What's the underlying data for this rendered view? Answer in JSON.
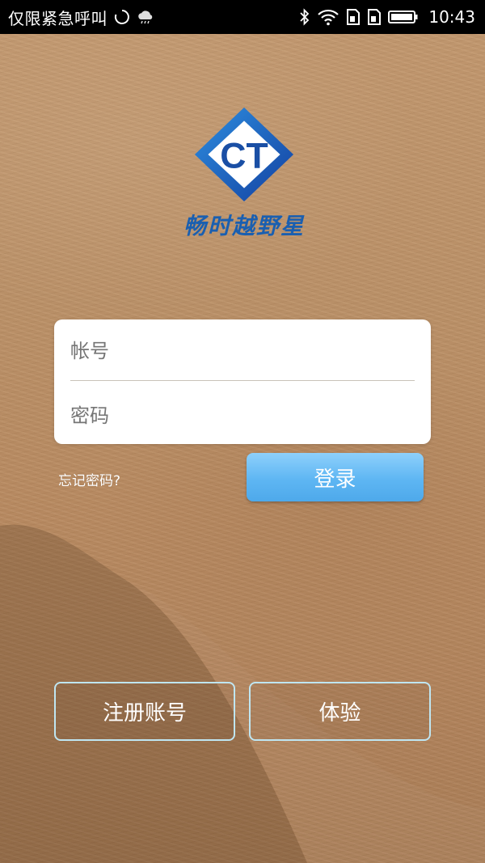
{
  "status_bar": {
    "carrier_text": "仅限紧急呼叫",
    "time": "10:43",
    "icons": [
      "loading-spinner-icon",
      "cloud-icon",
      "bluetooth-icon",
      "wifi-icon",
      "sim-card-icon",
      "sim-card-icon",
      "battery-icon"
    ]
  },
  "logo": {
    "mark_text": "CT",
    "name": "畅时越野星",
    "brand_color": "#1a5fb0"
  },
  "login_form": {
    "account_placeholder": "帐号",
    "account_value": "",
    "password_placeholder": "密码",
    "password_value": "",
    "forgot_password": "忘记密码?",
    "login_label": "登录",
    "login_button_color": "#5eb6f3"
  },
  "bottom_actions": {
    "register_label": "注册账号",
    "trial_label": "体验"
  }
}
